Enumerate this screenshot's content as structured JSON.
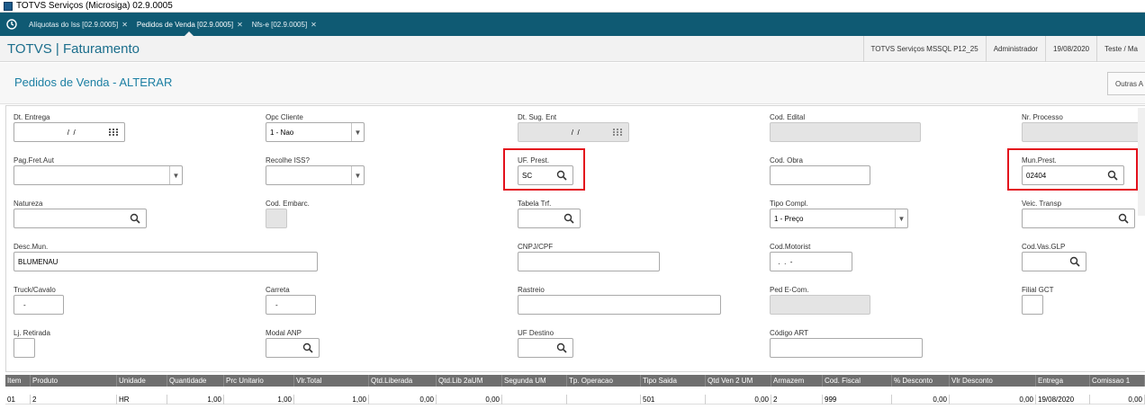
{
  "window": {
    "title": "TOTVS Serviços (Microsiga) 02.9.0005"
  },
  "tabs": [
    {
      "label": "Alíquotas do Iss [02.9.0005]"
    },
    {
      "label": "Pedidos de Venda [02.9.0005]"
    },
    {
      "label": "Nfs-e [02.9.0005]"
    }
  ],
  "header": {
    "brand": "TOTVS | Faturamento",
    "environment": "TOTVS Serviços MSSQL P12_25",
    "user": "Administrador",
    "date": "19/08/2020",
    "company": "Teste / Ma"
  },
  "page": {
    "title": "Pedidos de Venda - ALTERAR",
    "other_actions": "Outras A"
  },
  "fields": {
    "dt_entrega": {
      "label": "Dt. Entrega",
      "value": "  /  /"
    },
    "opc_cliente": {
      "label": "Opc Cliente",
      "value": "1 - Nao"
    },
    "dt_sug_ent": {
      "label": "Dt. Sug. Ent",
      "value": "  /  /"
    },
    "cod_edital": {
      "label": "Cod. Edital",
      "value": ""
    },
    "nr_processo": {
      "label": "Nr. Processo",
      "value": ""
    },
    "pag_fret_aut": {
      "label": "Pag.Fret.Aut",
      "value": ""
    },
    "recolhe_iss": {
      "label": "Recolhe ISS?",
      "value": ""
    },
    "uf_prest": {
      "label": "UF. Prest.",
      "value": "SC"
    },
    "cod_obra": {
      "label": "Cod. Obra",
      "value": ""
    },
    "mun_prest": {
      "label": "Mun.Prest.",
      "value": "02404"
    },
    "natureza": {
      "label": "Natureza",
      "value": ""
    },
    "cod_embarc": {
      "label": "Cod. Embarc.",
      "value": ""
    },
    "tabela_trf": {
      "label": "Tabela Trf.",
      "value": ""
    },
    "tipo_compl": {
      "label": "Tipo Compl.",
      "value": "1 - Preço"
    },
    "veic_transp": {
      "label": "Veic. Transp",
      "value": ""
    },
    "desc_mun": {
      "label": "Desc.Mun.",
      "value": "BLUMENAU"
    },
    "cnpj_cpf": {
      "label": "CNPJ/CPF",
      "value": ""
    },
    "cod_motorist": {
      "label": "Cod.Motorist",
      "value": "  .  .  -"
    },
    "cod_vas_glp": {
      "label": "Cod.Vas.GLP",
      "value": ""
    },
    "truck_cavalo": {
      "label": "Truck/Cavalo",
      "value": "-"
    },
    "carreta": {
      "label": "Carreta",
      "value": "-"
    },
    "rastreio": {
      "label": "Rastreio",
      "value": ""
    },
    "ped_e_com": {
      "label": "Ped E-Com.",
      "value": ""
    },
    "filial_gct": {
      "label": "Filial GCT",
      "value": ""
    },
    "lj_retirada": {
      "label": "Lj. Retirada",
      "value": ""
    },
    "modal_anp": {
      "label": "Modal ANP",
      "value": ""
    },
    "uf_destino": {
      "label": "UF Destino",
      "value": ""
    },
    "codigo_art": {
      "label": "Código ART",
      "value": ""
    }
  },
  "grid": {
    "headers": [
      "Item",
      "Produto",
      "Unidade",
      "Quantidade",
      "Prc Unitario",
      "Vlr.Total",
      "Qtd.Liberada",
      "Qtd.Lib 2aUM",
      "Segunda UM",
      "Tp. Operacao",
      "Tipo Saida",
      "Qtd Ven 2 UM",
      "Armazem",
      "Cod. Fiscal",
      "% Desconto",
      "Vlr Desconto",
      "Entrega",
      "Comissao 1"
    ],
    "row": [
      "01",
      "2",
      "HR",
      "1,00",
      "1,00",
      "1,00",
      "0,00",
      "0,00",
      "",
      "",
      "501",
      "0,00",
      "2",
      "999",
      "0,00",
      "0,00",
      "19/08/2020",
      "0,00"
    ]
  },
  "colors": {
    "tabbar": "#0f5a73",
    "brand": "#1b6e8c",
    "highlight": "#e3101c"
  }
}
